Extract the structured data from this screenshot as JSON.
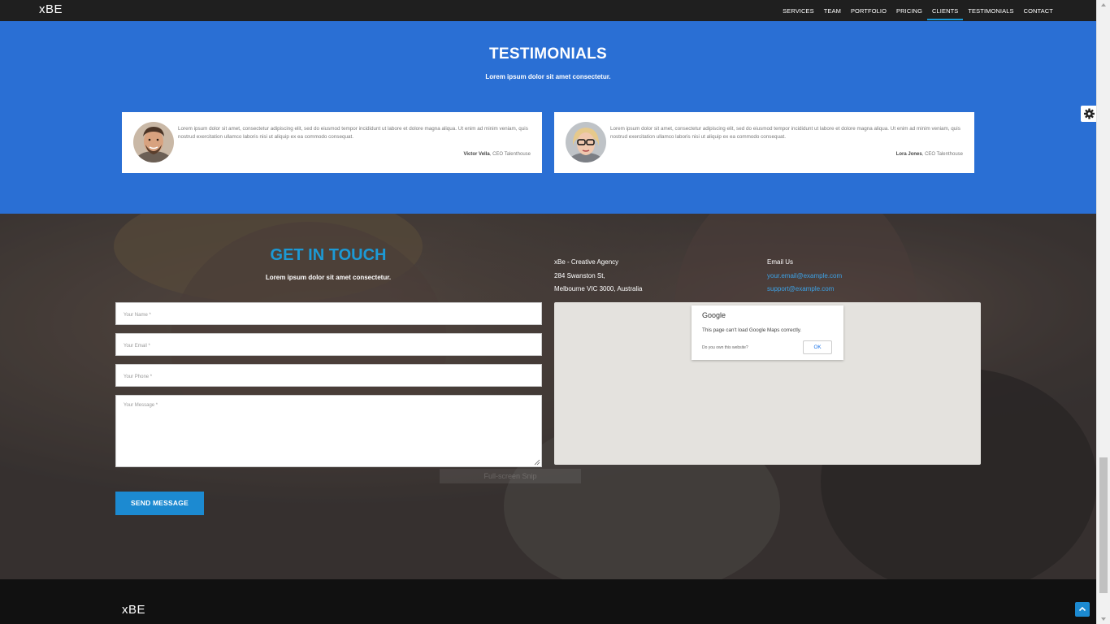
{
  "navbar": {
    "brand": "xBE",
    "items": [
      "SERVICES",
      "TEAM",
      "PORTFOLIO",
      "PRICING",
      "CLIENTS",
      "TESTIMONIALS",
      "CONTACT"
    ],
    "active": "CLIENTS"
  },
  "testimonials": {
    "title": "TESTIMONIALS",
    "subtitle": "Lorem ipsum dolor sit amet consectetur.",
    "cards": [
      {
        "text": "Lorem ipsum dolor sit amet, consectetur adipiscing elit, sed do eiusmod tempor incididunt ut labore et dolore magna aliqua. Ut enim ad minim veniam, quis nostrud exercitation ullamco laboris nisi ut aliquip ex ea commodo consequat.",
        "name": "Victor Vella",
        "role": ", CEO Talenthouse"
      },
      {
        "text": "Lorem ipsum dolor sit amet, consectetur adipiscing elit, sed do eiusmod tempor incididunt ut labore et dolore magna aliqua. Ut enim ad minim veniam, quis nostrud exercitation ullamco laboris nisi ut aliquip ex ea commodo consequat.",
        "name": "Lora Jones",
        "role": ", CEO Talenthouse"
      }
    ]
  },
  "contact": {
    "title": "GET IN TOUCH",
    "subtitle": "Lorem ipsum dolor sit amet consectetur.",
    "fields": {
      "name": "Your Name *",
      "email": "Your Email *",
      "phone": "Your Phone *",
      "message": "Your Message *"
    },
    "send_label": "SEND MESSAGE",
    "fullscreen_label": "Full-screen Snip",
    "address": [
      "xBe - Creative Agency",
      "284 Swanston St,",
      "Melbourne VIC 3000, Australia"
    ],
    "email_label": "Email Us",
    "emails": [
      "your.email@example.com",
      "support@example.com"
    ],
    "map": {
      "logo": "Google",
      "message": "This page can't load Google Maps correctly.",
      "own_link": "Do you own this website?",
      "ok_label": "OK"
    }
  },
  "footer": {
    "brand": "xBE"
  },
  "colors": {
    "accent": "#1c9ad6",
    "testimonials_bg": "#2a6fd4",
    "button": "#1c8ad1",
    "footer_bg": "#111111"
  },
  "icons": [
    "settings-gear-icon",
    "scroll-to-top-icon",
    "resize-handle-icon"
  ]
}
